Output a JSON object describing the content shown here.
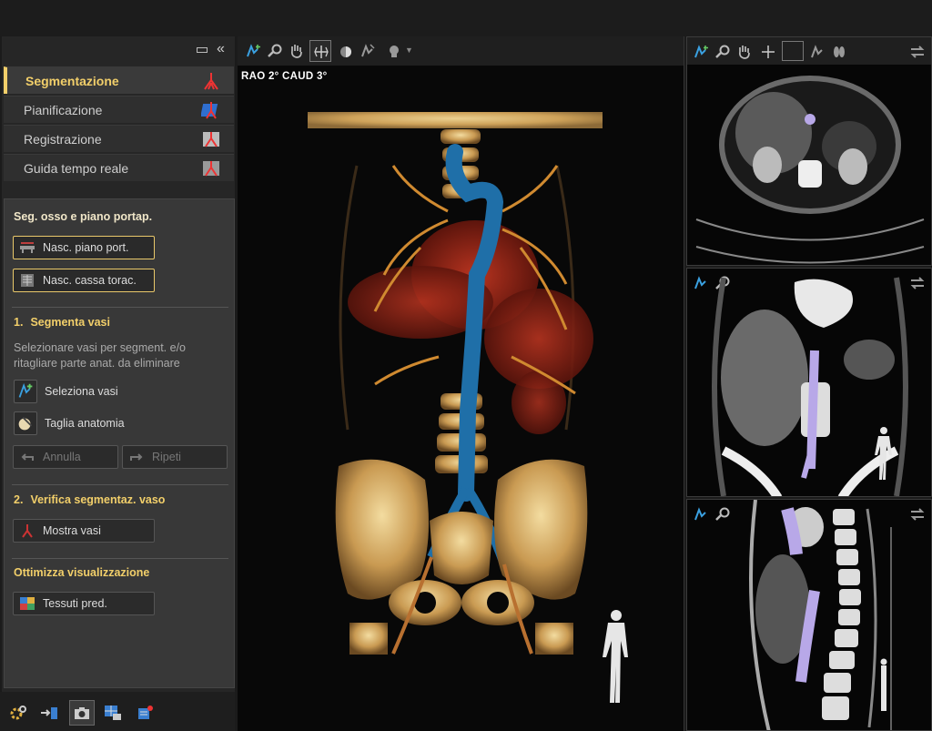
{
  "workflow": {
    "items": [
      {
        "label": "Segmentazione",
        "active": true,
        "icon": "vessel-tree-icon"
      },
      {
        "label": "Pianificazione",
        "active": false,
        "icon": "plan-icon"
      },
      {
        "label": "Registrazione",
        "active": false,
        "icon": "registration-icon"
      },
      {
        "label": "Guida tempo reale",
        "active": false,
        "icon": "live-guidance-icon"
      }
    ]
  },
  "tools": {
    "bone_section": {
      "title": "Seg. osso e piano portap.",
      "hide_table_btn": "Nasc. piano port.",
      "hide_ribcage_btn": "Nasc. cassa torac."
    },
    "step1": {
      "number": "1.",
      "title": "Segmenta vasi",
      "hint": "Selezionare vasi per segment. e/o ritagliare parte anat. da eliminare",
      "select_vessels": "Seleziona vasi",
      "cut_anatomy": "Taglia anatomia",
      "undo": "Annulla",
      "redo": "Ripeti"
    },
    "step2": {
      "number": "2.",
      "title": "Verifica segmentaz. vaso",
      "show_vessels": "Mostra vasi"
    },
    "optimize": {
      "title": "Ottimizza visualizzazione",
      "preset_tissues": "Tessuti pred."
    }
  },
  "view3d": {
    "orientation": "RAO  2° CAUD  3°"
  },
  "colors": {
    "accent": "#f2cf6a",
    "vessel_blue": "#1f6fa8",
    "bone": "#d9b46a",
    "artery_red": "#8c1a12"
  }
}
